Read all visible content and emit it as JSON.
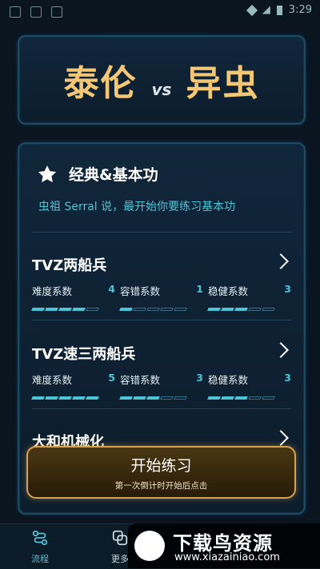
{
  "header": {
    "left": "泰伦",
    "vs": "vs",
    "right": "异虫"
  },
  "section": {
    "title": "经典&基本功",
    "description": "虫祖 Serral 说，最开始你要练习基本功"
  },
  "items": [
    {
      "title": "TVZ两船兵",
      "stats": [
        {
          "label": "难度系数",
          "value": "4",
          "level": 4
        },
        {
          "label": "容错系数",
          "value": "1",
          "level": 1
        },
        {
          "label": "稳健系数",
          "value": "3",
          "level": 3
        }
      ]
    },
    {
      "title": "TVZ速三两船兵",
      "stats": [
        {
          "label": "难度系数",
          "value": "5",
          "level": 5
        },
        {
          "label": "容错系数",
          "value": "3",
          "level": 3
        },
        {
          "label": "稳健系数",
          "value": "3",
          "level": 3
        }
      ]
    },
    {
      "title": "大和机械化",
      "stats": []
    }
  ],
  "start_button": {
    "label": "开始练习",
    "sub": "第一次倒计时开始后点击"
  },
  "nav": {
    "items": [
      {
        "label": "流程",
        "active": true
      },
      {
        "label": "更多",
        "active": false
      }
    ]
  },
  "status": {
    "time": "3:29"
  },
  "watermark": {
    "title": "下载鸟资源",
    "url": "www.xiazainiao.com"
  },
  "colors": {
    "accent": "#4fc3d6",
    "gold": "#f4c777",
    "button_border": "#d9a24c"
  }
}
